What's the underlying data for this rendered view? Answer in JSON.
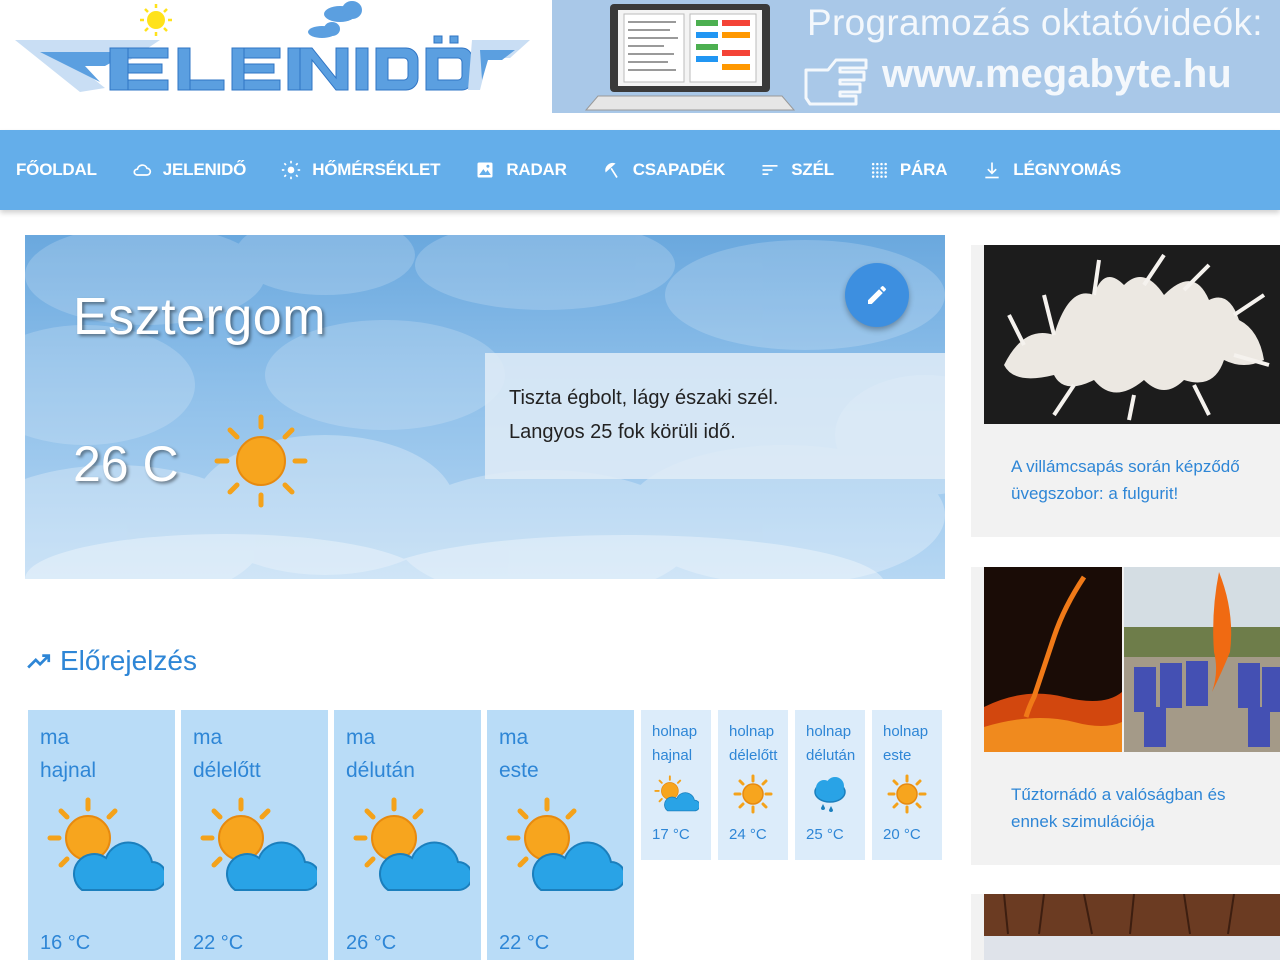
{
  "header": {
    "logo_text": "JELENIDŐ",
    "banner": {
      "line1": "Programozás oktatóvideók:",
      "line2": "www.megabyte.hu"
    }
  },
  "nav": {
    "items": [
      {
        "label": "FŐOLDAL",
        "icon": ""
      },
      {
        "label": "JELENIDŐ",
        "icon": "cloud-icon"
      },
      {
        "label": "HŐMÉRSÉKLET",
        "icon": "sun-icon"
      },
      {
        "label": "RADAR",
        "icon": "image-icon"
      },
      {
        "label": "CSAPADÉK",
        "icon": "umbrella-icon"
      },
      {
        "label": "SZÉL",
        "icon": "wind-icon"
      },
      {
        "label": "PÁRA",
        "icon": "dots-grid-icon"
      },
      {
        "label": "LÉGNYOMÁS",
        "icon": "download-arrow-icon"
      }
    ]
  },
  "hero": {
    "city": "Esztergom",
    "temperature": "26 C",
    "icon": "sun-icon",
    "description": [
      "Tiszta égbolt, lágy északi szél.",
      "Langyos 25 fok körüli idő."
    ]
  },
  "forecast": {
    "title": "Előrejelzés",
    "today": [
      {
        "day": "ma",
        "period": "hajnal",
        "temp": "16 °C",
        "icon": "sun-cloud-icon"
      },
      {
        "day": "ma",
        "period": "délelőtt",
        "temp": "22 °C",
        "icon": "sun-cloud-icon"
      },
      {
        "day": "ma",
        "period": "délután",
        "temp": "26 °C",
        "icon": "sun-cloud-icon"
      },
      {
        "day": "ma",
        "period": "este",
        "temp": "22 °C",
        "icon": "sun-cloud-icon"
      }
    ],
    "tomorrow": [
      {
        "day": "holnap",
        "period": "hajnal",
        "temp": "17 °C",
        "icon": "sun-cloud-icon"
      },
      {
        "day": "holnap",
        "period": "délelőtt",
        "temp": "24 °C",
        "icon": "sun-icon"
      },
      {
        "day": "holnap",
        "period": "délután",
        "temp": "25 °C",
        "icon": "rain-cloud-icon"
      },
      {
        "day": "holnap",
        "period": "este",
        "temp": "20 °C",
        "icon": "sun-icon"
      }
    ]
  },
  "sidebar": {
    "articles": [
      {
        "caption_lines": [
          "A villámcsapás során képződő",
          "üvegszobor: a fulgurit!"
        ],
        "image": "fulgurite-photo"
      },
      {
        "caption_lines": [
          "Tűztornádó a valóságban és",
          "ennek szimulációja"
        ],
        "image": "fire-tornado-photo"
      },
      {
        "caption_lines": [],
        "image": "winter-landscape-photo"
      }
    ]
  },
  "colors": {
    "nav_bg": "#64aeea",
    "accent": "#2e86d6",
    "card_big": "#b9dcf7",
    "card_small": "#dcecfa",
    "edit_button": "#3d8fe0"
  }
}
